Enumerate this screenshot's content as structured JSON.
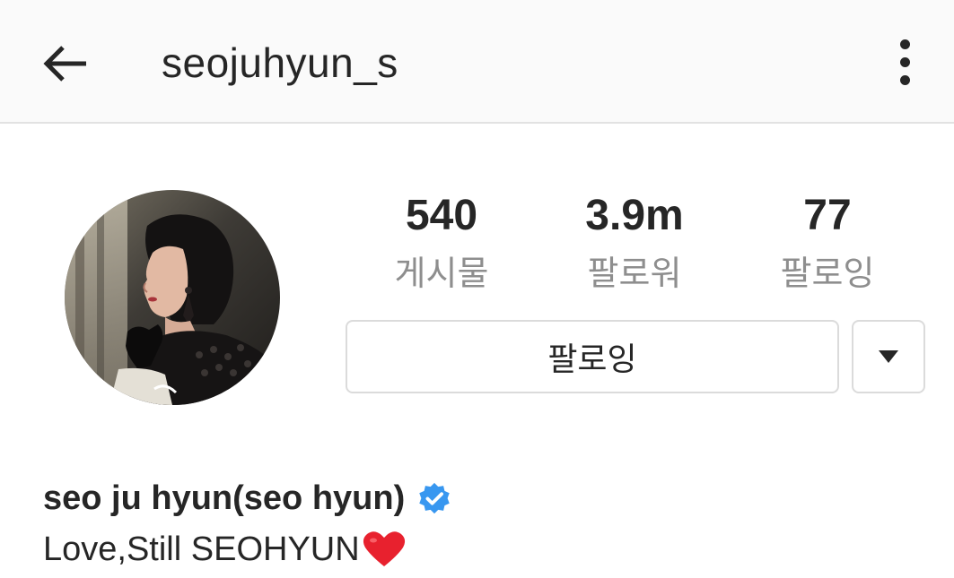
{
  "header": {
    "username": "seojuhyun_s",
    "back_icon": "arrow-left-icon",
    "menu_icon": "more-vertical-icon"
  },
  "profile": {
    "avatar_icon": "profile-photo",
    "stats": [
      {
        "value": "540",
        "label": "게시물"
      },
      {
        "value": "3.9m",
        "label": "팔로워"
      },
      {
        "value": "77",
        "label": "팔로잉"
      }
    ],
    "follow_button_label": "팔로잉",
    "dropdown_icon": "triangle-down-icon",
    "full_name": "seo ju hyun(seo hyun)",
    "verified_icon": "verified-badge-icon",
    "bio": "Love,Still SEOHYUN",
    "bio_emoji_icon": "red-heart-icon"
  },
  "colors": {
    "verified_blue": "#3897f0",
    "heart_red": "#e8212e",
    "secondary_text": "#8e8e8e",
    "border": "#dbdbdb"
  }
}
